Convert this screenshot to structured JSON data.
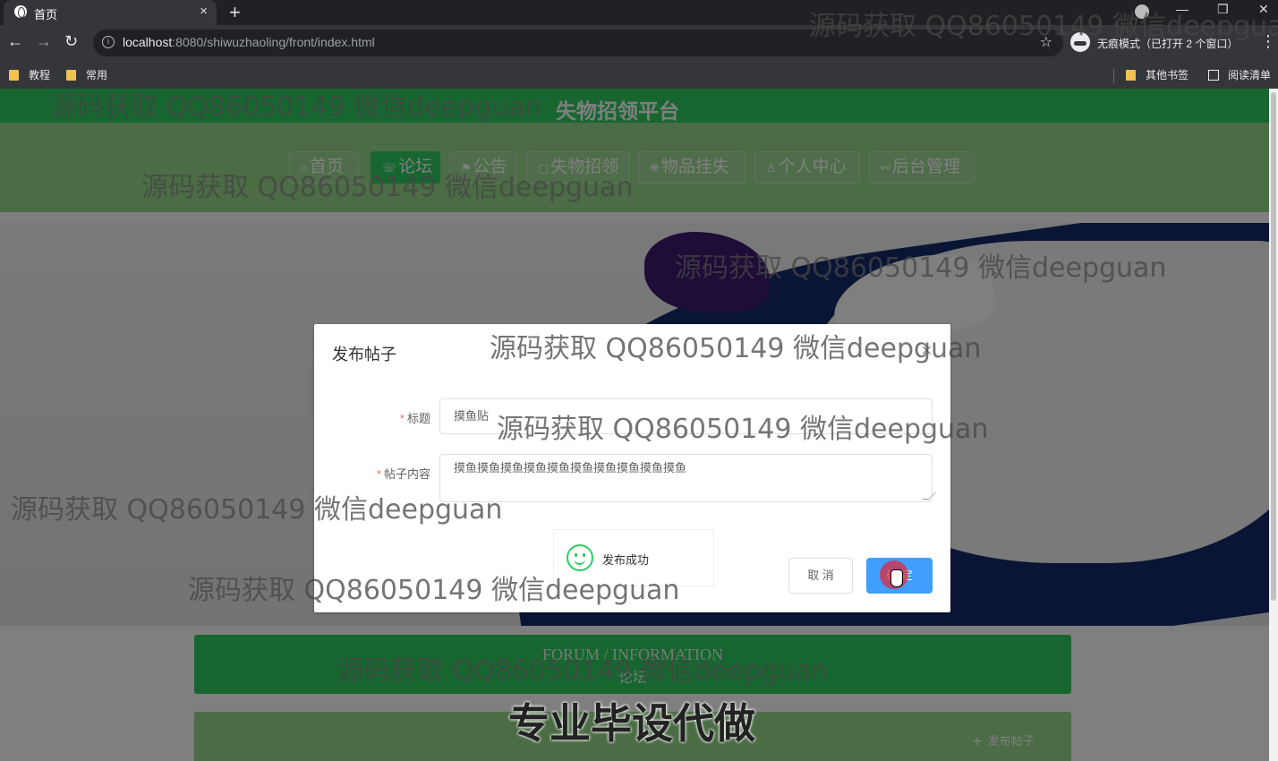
{
  "browser": {
    "tab_title": "首页",
    "tab_close": "×",
    "new_tab": "+",
    "url_host": "localhost",
    "url_path": ":8080/shiwuzhaoling/front/index.html",
    "incognito_text": "无痕模式（已打开 2 个窗口）",
    "bookmarks": [
      "教程",
      "常用"
    ],
    "bookmarks_right": [
      "其他书签",
      "阅读清单"
    ]
  },
  "site": {
    "title": "失物招领平台",
    "nav": [
      {
        "label": "首页",
        "icon": "home-icon"
      },
      {
        "label": "论坛",
        "icon": "forum-icon"
      },
      {
        "label": "公告",
        "icon": "notice-icon"
      },
      {
        "label": "失物招领",
        "icon": "lostfound-icon"
      },
      {
        "label": "物品挂失",
        "icon": "report-icon"
      },
      {
        "label": "个人中心",
        "icon": "user-icon"
      },
      {
        "label": "后台管理",
        "icon": "link-icon"
      }
    ],
    "active_nav": "论坛"
  },
  "forum": {
    "title_en": "FORUM / INFORMATION",
    "title_cn": "论坛",
    "publish_label": "发布帖子"
  },
  "dialog": {
    "title": "发布帖子",
    "title_label": "标题",
    "title_value": "摸鱼贴",
    "content_label": "帖子内容",
    "content_value": "摸鱼摸鱼摸鱼摸鱼摸鱼摸鱼摸鱼摸鱼摸鱼摸鱼",
    "cancel_label": "取 消",
    "ok_label": "确 定",
    "toast_message": "发布成功"
  },
  "watermark": {
    "text": "源码获取 QQ86050149 微信deepguan",
    "banner": "专业毕设代做"
  },
  "colors": {
    "primary_green": "#2ecc60",
    "nav_green": "#97d88b",
    "button_blue": "#409eff"
  }
}
